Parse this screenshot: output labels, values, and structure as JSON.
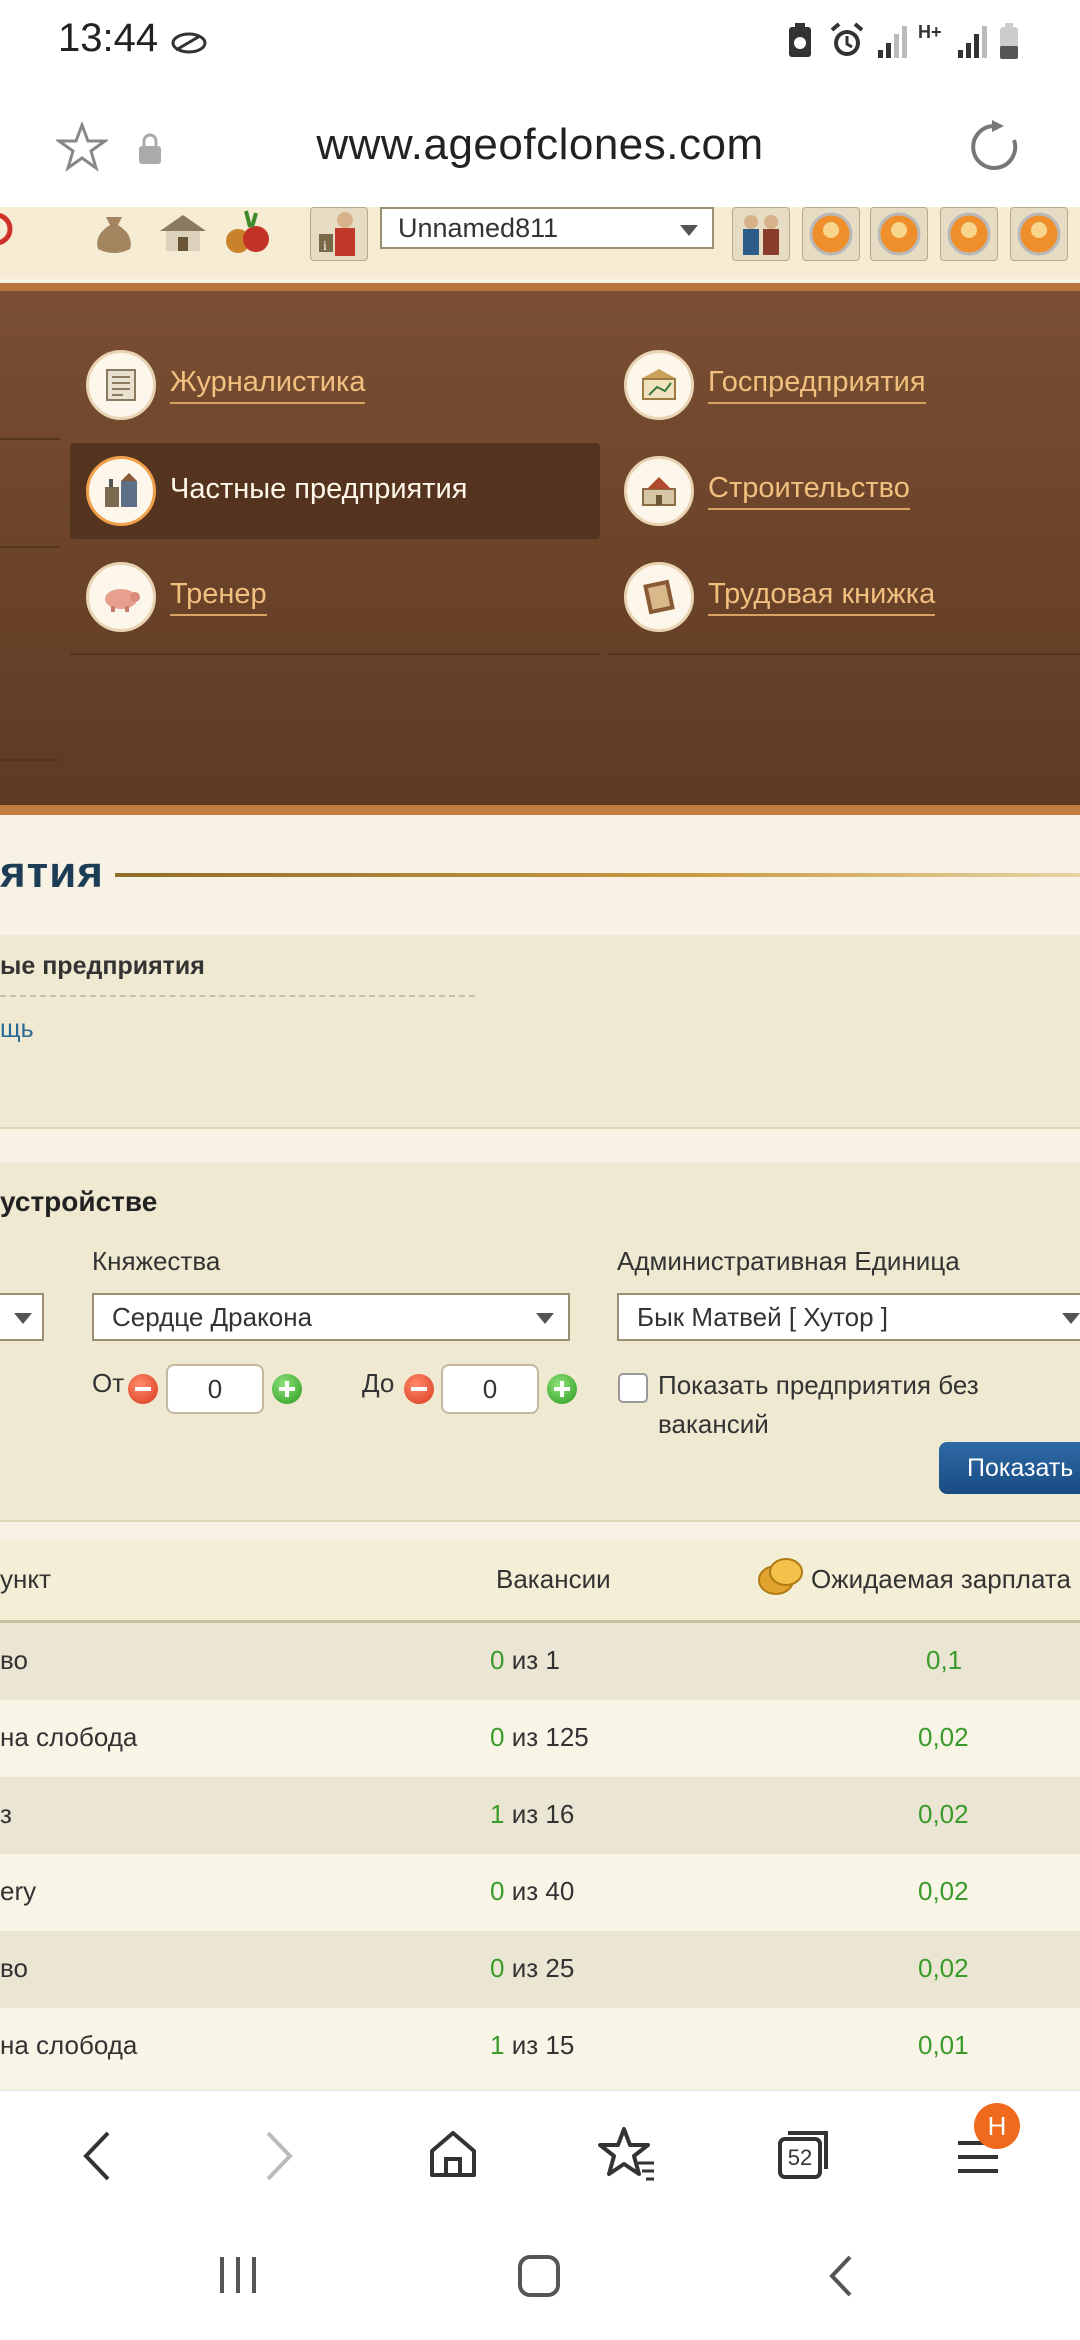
{
  "status": {
    "time": "13:44",
    "net_label": "H+"
  },
  "url_bar": {
    "url": "www.ageofclones.com"
  },
  "top_strip": {
    "username": "Unnamed811"
  },
  "menu": {
    "items": [
      {
        "label": "Журналистика",
        "icon": "newspaper-icon"
      },
      {
        "label": "Госпредприятия",
        "icon": "state-building-icon"
      },
      {
        "label": "Частные предприятия",
        "icon": "private-enterprise-icon",
        "active": true
      },
      {
        "label": "Строительство",
        "icon": "construction-icon"
      },
      {
        "label": "Тренер",
        "icon": "pig-icon"
      },
      {
        "label": "Трудовая книжка",
        "icon": "workbook-icon"
      }
    ]
  },
  "section": {
    "title": "ятия"
  },
  "breadcrumb": {
    "item1": "ые предприятия",
    "item2": "щь"
  },
  "filter": {
    "title": "устройстве",
    "principality_label": "Княжества",
    "principality_value": "Сердце Дракона",
    "admin_label": "Административная Единица",
    "admin_value": "Бык Матвей [ Хутор ]",
    "from_label": "От",
    "from_value": "0",
    "to_label": "До",
    "to_value": "0",
    "checkbox_label": "Показать предприятия без вакансий",
    "show_button": "Показать"
  },
  "table": {
    "headers": {
      "point": "ункт",
      "vacancies": "Вакансии",
      "salary": "Ожидаемая зарплата"
    },
    "rows": [
      {
        "point": "во",
        "vac_open": "0",
        "vac_rest": " из 1",
        "salary": "0,1"
      },
      {
        "point": "на слобода",
        "vac_open": "0",
        "vac_rest": " из 125",
        "salary": "0,02"
      },
      {
        "point": "з",
        "vac_open": "1",
        "vac_rest": " из 16",
        "salary": "0,02"
      },
      {
        "point": "ery",
        "vac_open": "0",
        "vac_rest": " из 40",
        "salary": "0,02"
      },
      {
        "point": "во",
        "vac_open": "0",
        "vac_rest": " из 25",
        "salary": "0,02"
      },
      {
        "point": "на слобода",
        "vac_open": "1",
        "vac_rest": " из 15",
        "salary": "0,01"
      }
    ]
  },
  "browser_nav": {
    "tabs_count": "52",
    "menu_badge": "H"
  }
}
